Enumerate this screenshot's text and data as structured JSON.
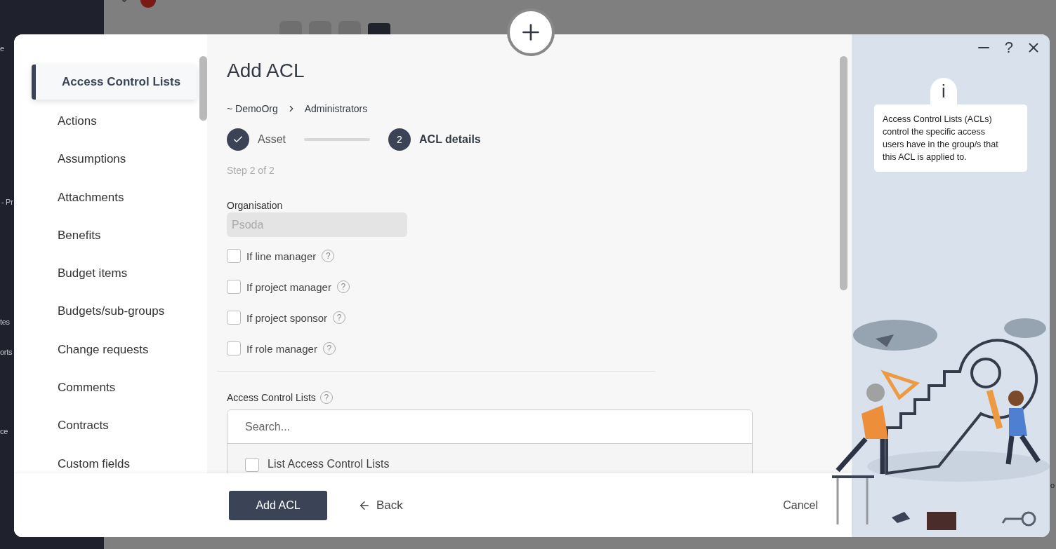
{
  "background_page": {
    "sidebar_fragments": [
      "e",
      "- Pr",
      "tes",
      "orts",
      "ce"
    ],
    "right_fragment": "o"
  },
  "modal": {
    "nav": [
      {
        "label": "Access Control Lists",
        "selected": true
      },
      {
        "label": "Actions",
        "selected": false
      },
      {
        "label": "Assumptions",
        "selected": false
      },
      {
        "label": "Attachments",
        "selected": false
      },
      {
        "label": "Benefits",
        "selected": false
      },
      {
        "label": "Budget items",
        "selected": false
      },
      {
        "label": "Budgets/sub-groups",
        "selected": false
      },
      {
        "label": "Change requests",
        "selected": false
      },
      {
        "label": "Comments",
        "selected": false
      },
      {
        "label": "Contracts",
        "selected": false
      },
      {
        "label": "Custom fields",
        "selected": false
      }
    ],
    "title": "Add ACL",
    "breadcrumb": [
      "~ DemoOrg",
      "Administrators"
    ],
    "steps": [
      {
        "label": "Asset",
        "done": true
      },
      {
        "label": "ACL details",
        "done": false,
        "number": "2"
      }
    ],
    "step_caption": "Step 2 of 2",
    "organisation": {
      "label": "Organisation",
      "value": "Psoda",
      "disabled": true
    },
    "conditions": [
      {
        "label": "If line manager",
        "checked": false,
        "help": "?"
      },
      {
        "label": "If project manager",
        "checked": false,
        "help": "?"
      },
      {
        "label": "If project sponsor",
        "checked": false,
        "help": "?"
      },
      {
        "label": "If role manager",
        "checked": false,
        "help": "?"
      }
    ],
    "acl": {
      "label": "Access Control Lists",
      "help": "?",
      "placeholder": "Search...",
      "items": [
        {
          "label": "List Access Control Lists",
          "checked": false
        }
      ]
    },
    "footer": {
      "primary": "Add ACL",
      "back": "Back",
      "cancel": "Cancel"
    },
    "help": {
      "window_help": "?",
      "badge": "i",
      "text": "Access Control Lists (ACLs) control the specific access users have in the group/s that this ACL is applied to."
    }
  }
}
